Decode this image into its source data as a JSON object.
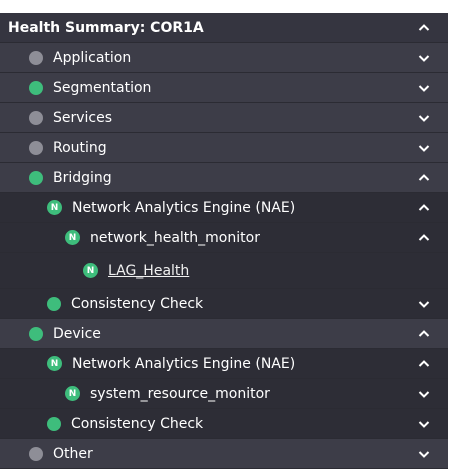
{
  "panel": {
    "title": "Health Summary: COR1A",
    "rows": [
      {
        "label": "Application",
        "status": "gray",
        "chevron": "down"
      },
      {
        "label": "Segmentation",
        "status": "green",
        "chevron": "down"
      },
      {
        "label": "Services",
        "status": "gray",
        "chevron": "down"
      },
      {
        "label": "Routing",
        "status": "gray",
        "chevron": "down"
      },
      {
        "label": "Bridging",
        "status": "green",
        "chevron": "up"
      },
      {
        "label": "Network Analytics Engine (NAE)",
        "badge": "N",
        "chevron": "up"
      },
      {
        "label": "network_health_monitor",
        "badge": "N",
        "chevron": "up"
      },
      {
        "label": "LAG_Health",
        "badge": "N"
      },
      {
        "label": "Consistency Check",
        "status": "green",
        "chevron": "down"
      },
      {
        "label": "Device",
        "status": "green",
        "chevron": "up"
      },
      {
        "label": "Network Analytics Engine (NAE)",
        "badge": "N",
        "chevron": "up"
      },
      {
        "label": "system_resource_monitor",
        "badge": "N",
        "chevron": "down"
      },
      {
        "label": "Consistency Check",
        "status": "green",
        "chevron": "down"
      },
      {
        "label": "Other",
        "status": "gray",
        "chevron": "down"
      }
    ]
  },
  "colors": {
    "status_green": "#3ebd7c",
    "status_gray": "#8e8e97",
    "panel_background": "#3a3a44",
    "nested_background": "#2d2d36"
  }
}
